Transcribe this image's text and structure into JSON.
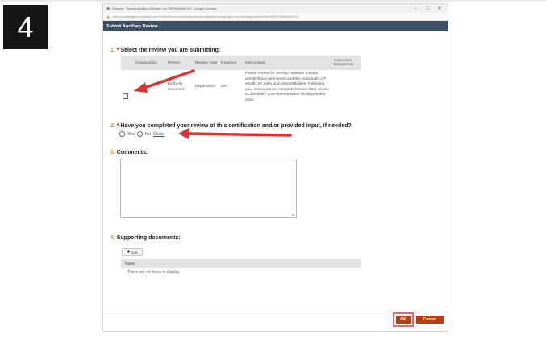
{
  "tutorial": {
    "step_number": "4",
    "annotation_color": "#dc3232"
  },
  "browser": {
    "window_title": "Execute \"Submit Ancillary Review\" on CRP0000000 00 - Google Chrome",
    "url": "https://hsceliwaged.huronclick.com/COI/sd/ResourceAdministration/Activity/form?ActivityType=com.webridge.entity.Entity%5BOID%5B9A8F6C8...",
    "minimize_glyph": "–",
    "maximize_glyph": "□",
    "close_glyph": "✕"
  },
  "panel": {
    "header": "Submit Ancillary Review",
    "header_color": "#3d4f61"
  },
  "q1": {
    "number": "1.",
    "required_mark": "*",
    "label": "Select the review you are submitting:",
    "columns": [
      "Organization",
      "Person",
      "Review Type",
      "Required",
      "Instructions",
      "Instruction Documents"
    ],
    "rows": [
      {
        "organization": "",
        "person": "Kimberly Summers",
        "review_type": "Department",
        "required": "yes",
        "instructions": "Please review for overlap between outside activity/financial interest and the individual's UT Health SA roles and responsibilities. Following your review please complete this ancillary review to document your determination as department chair.",
        "instruction_documents": ""
      }
    ]
  },
  "q2": {
    "number": "2.",
    "required_mark": "*",
    "label": "Have you completed your review of this certification and/or provided input, if needed?",
    "option_yes": "Yes",
    "option_no": "No",
    "clear_label": "Clear"
  },
  "q3": {
    "number": "3.",
    "label": "Comments:",
    "value": ""
  },
  "q4": {
    "number": "4.",
    "label": "Supporting documents:",
    "add_label": "Add",
    "column_name": "Name",
    "empty_text": "There are no items to display"
  },
  "footer": {
    "ok_label": "OK",
    "cancel_label": "Cancel",
    "button_color": "#b8400f"
  }
}
